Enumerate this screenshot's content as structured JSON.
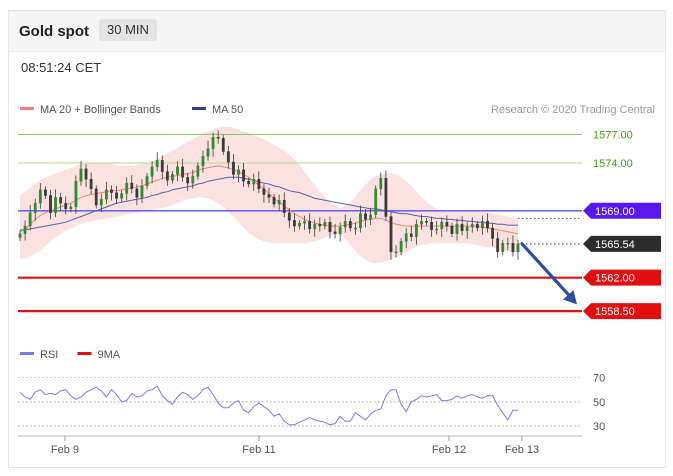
{
  "header": {
    "title": "Gold spot",
    "interval": "30 MIN"
  },
  "timestamp": "08:51:24 CET",
  "legend_price": [
    {
      "label": "MA 20 + Bollinger Bands",
      "color": "#f08080"
    },
    {
      "label": "MA 50",
      "color": "#2e3f8f"
    }
  ],
  "credit": "Research © 2020 Trading Central",
  "legend_rsi": [
    {
      "label": "RSI",
      "color": "#7b7be8"
    },
    {
      "label": "9MA",
      "color": "#e01010"
    }
  ],
  "chart_data": {
    "type": "candlestick",
    "price_ylim": [
      1556,
      1578.5
    ],
    "x_ticks": [
      {
        "label": "Feb 9",
        "index": 8
      },
      {
        "label": "Feb 11",
        "index": 42
      },
      {
        "label": "Feb 12",
        "index": 77
      },
      {
        "label": "Feb 13",
        "index": 89
      }
    ],
    "levels": [
      {
        "label": "1577.00",
        "value": 1577.0,
        "kind": "green",
        "color": "#7ec95a",
        "text_color": "#44a012"
      },
      {
        "label": "1574.00",
        "value": 1574.0,
        "kind": "green",
        "color": "#b6d98a",
        "text_color": "#44a012"
      },
      {
        "label": "1569.00",
        "value": 1569.0,
        "kind": "resistance",
        "color": "#6a6af0",
        "tag_color": "#5a18f0"
      },
      {
        "label": "1565.54",
        "value": 1565.54,
        "kind": "last",
        "color": "#333333",
        "tag_color": "#2c2c2c"
      },
      {
        "label": "1562.00",
        "value": 1562.0,
        "kind": "support",
        "color": "#e01010",
        "tag_color": "#e01010"
      },
      {
        "label": "1558.50",
        "value": 1558.5,
        "kind": "support",
        "color": "#e01010",
        "tag_color": "#e01010"
      }
    ],
    "close": [
      1566.6,
      1567.4,
      1568.8,
      1569.8,
      1571.2,
      1570.6,
      1568.8,
      1570.4,
      1569.8,
      1569.2,
      1569.4,
      1572.1,
      1573.4,
      1572.3,
      1571.3,
      1569.6,
      1570.2,
      1571.2,
      1570.9,
      1570.3,
      1570.8,
      1571.9,
      1571.3,
      1570.4,
      1571.6,
      1572.6,
      1573.6,
      1574.3,
      1573.1,
      1572.2,
      1572.8,
      1573.6,
      1572.5,
      1571.9,
      1572.6,
      1573.7,
      1574.7,
      1575.5,
      1576.7,
      1576.6,
      1575.2,
      1574.1,
      1572.8,
      1573.3,
      1572.1,
      1571.8,
      1572.3,
      1571.3,
      1570.7,
      1570.4,
      1569.7,
      1570.1,
      1568.8,
      1568.0,
      1567.4,
      1567.7,
      1567.9,
      1567.1,
      1567.6,
      1567.4,
      1567.8,
      1566.8,
      1566.6,
      1567.3,
      1567.9,
      1567.2,
      1567.2,
      1568.7,
      1568.1,
      1568.6,
      1571.3,
      1572.4,
      1568.4,
      1564.7,
      1564.7,
      1565.8,
      1566.6,
      1566.3,
      1567.6,
      1567.9,
      1567.8,
      1567.0,
      1567.1,
      1567.8,
      1567.4,
      1566.6,
      1567.6,
      1566.9,
      1567.3,
      1567.6,
      1567.2,
      1567.9,
      1567.2,
      1566.1,
      1564.7,
      1565.6,
      1565.6,
      1564.7,
      1565.5
    ],
    "ma20": [
      1566.8,
      1567.0,
      1567.6,
      1568.1,
      1568.5,
      1568.8,
      1569.0,
      1569.2,
      1569.4,
      1569.6,
      1569.8,
      1570.1,
      1570.4,
      1570.6,
      1570.7,
      1570.8,
      1570.9,
      1571.0,
      1571.1,
      1571.1,
      1571.2,
      1571.3,
      1571.4,
      1571.5,
      1571.6,
      1571.8,
      1572.0,
      1572.2,
      1572.4,
      1572.5,
      1572.6,
      1572.7,
      1572.8,
      1572.9,
      1573.0,
      1573.2,
      1573.4,
      1573.5,
      1573.6,
      1573.7,
      1573.6,
      1573.5,
      1573.3,
      1573.1,
      1572.8,
      1572.5,
      1572.1,
      1571.7,
      1571.3,
      1570.8,
      1570.3,
      1569.9,
      1569.5,
      1569.1,
      1568.7,
      1568.4,
      1568.1,
      1567.9,
      1567.7,
      1567.6,
      1567.5,
      1567.4,
      1567.4,
      1567.4,
      1567.5,
      1567.6,
      1567.7,
      1567.9,
      1568.0,
      1568.1,
      1568.2,
      1568.2,
      1568.0,
      1567.8,
      1567.6,
      1567.5,
      1567.4,
      1567.4,
      1567.4,
      1567.4,
      1567.4,
      1567.4,
      1567.4,
      1567.4,
      1567.4,
      1567.4,
      1567.4,
      1567.4,
      1567.4,
      1567.4,
      1567.4,
      1567.3,
      1567.2,
      1567.1,
      1567.0,
      1566.9,
      1566.8,
      1566.7,
      1566.6
    ],
    "bb_upper": [
      1570.6,
      1571.0,
      1571.4,
      1571.8,
      1572.2,
      1572.5,
      1572.7,
      1572.9,
      1573.1,
      1573.3,
      1573.5,
      1573.7,
      1573.9,
      1574.0,
      1574.0,
      1574.0,
      1574.0,
      1574.0,
      1573.9,
      1573.8,
      1573.7,
      1573.7,
      1573.7,
      1573.8,
      1573.9,
      1574.0,
      1574.2,
      1574.4,
      1574.7,
      1575.0,
      1575.3,
      1575.6,
      1575.9,
      1576.2,
      1576.5,
      1576.8,
      1577.1,
      1577.3,
      1577.5,
      1577.7,
      1577.8,
      1577.8,
      1577.7,
      1577.5,
      1577.3,
      1577.1,
      1576.9,
      1576.7,
      1576.5,
      1576.2,
      1575.9,
      1575.6,
      1575.3,
      1574.9,
      1574.4,
      1573.8,
      1573.1,
      1572.4,
      1571.7,
      1571.0,
      1570.4,
      1569.9,
      1569.5,
      1569.3,
      1569.5,
      1569.9,
      1570.5,
      1571.2,
      1571.8,
      1572.3,
      1572.6,
      1572.8,
      1572.9,
      1572.9,
      1572.8,
      1572.5,
      1572.1,
      1571.6,
      1571.0,
      1570.4,
      1569.9,
      1569.5,
      1569.2,
      1569.0,
      1568.9,
      1568.9,
      1568.9,
      1568.9,
      1568.9,
      1568.9,
      1568.9,
      1568.9,
      1568.8,
      1568.7,
      1568.6,
      1568.5,
      1568.4,
      1568.3,
      1568.2
    ],
    "bb_lower": [
      1564.0,
      1564.0,
      1564.2,
      1564.5,
      1564.9,
      1565.3,
      1565.8,
      1566.2,
      1566.6,
      1566.9,
      1567.2,
      1567.4,
      1567.6,
      1567.8,
      1567.9,
      1568.0,
      1568.1,
      1568.2,
      1568.3,
      1568.4,
      1568.5,
      1568.6,
      1568.7,
      1568.8,
      1568.9,
      1569.0,
      1569.1,
      1569.2,
      1569.3,
      1569.4,
      1569.6,
      1569.8,
      1570.0,
      1570.2,
      1570.3,
      1570.4,
      1570.4,
      1570.3,
      1570.1,
      1569.8,
      1569.4,
      1568.9,
      1568.4,
      1567.8,
      1567.2,
      1566.7,
      1566.3,
      1566.0,
      1565.8,
      1565.7,
      1565.6,
      1565.6,
      1565.6,
      1565.6,
      1565.6,
      1565.6,
      1565.6,
      1565.7,
      1565.8,
      1566.0,
      1566.2,
      1566.4,
      1566.6,
      1566.4,
      1566.0,
      1565.4,
      1564.8,
      1564.3,
      1563.9,
      1563.6,
      1563.5,
      1563.6,
      1563.7,
      1563.9,
      1564.1,
      1564.4,
      1564.7,
      1565.0,
      1565.2,
      1565.4,
      1565.5,
      1565.6,
      1565.6,
      1565.6,
      1565.6,
      1565.6,
      1565.6,
      1565.6,
      1565.6,
      1565.5,
      1565.4,
      1565.3,
      1565.2,
      1565.1,
      1565.0,
      1564.9,
      1564.8,
      1564.7,
      1564.6
    ],
    "ma50": [
      1567.0,
      1567.0,
      1567.1,
      1567.2,
      1567.3,
      1567.4,
      1567.5,
      1567.6,
      1567.7,
      1567.8,
      1568.0,
      1568.2,
      1568.4,
      1568.6,
      1568.8,
      1569.0,
      1569.2,
      1569.4,
      1569.6,
      1569.8,
      1569.9,
      1570.0,
      1570.1,
      1570.2,
      1570.3,
      1570.4,
      1570.6,
      1570.7,
      1570.9,
      1571.0,
      1571.2,
      1571.3,
      1571.4,
      1571.5,
      1571.6,
      1571.8,
      1571.9,
      1572.1,
      1572.2,
      1572.3,
      1572.4,
      1572.5,
      1572.5,
      1572.5,
      1572.4,
      1572.3,
      1572.2,
      1572.0,
      1571.9,
      1571.8,
      1571.6,
      1571.5,
      1571.3,
      1571.1,
      1571.0,
      1570.9,
      1570.7,
      1570.5,
      1570.3,
      1570.2,
      1570.1,
      1570.0,
      1569.9,
      1569.8,
      1569.7,
      1569.6,
      1569.5,
      1569.4,
      1569.3,
      1569.2,
      1569.2,
      1569.1,
      1569.0,
      1568.9,
      1568.8,
      1568.7,
      1568.7,
      1568.6,
      1568.5,
      1568.4,
      1568.4,
      1568.3,
      1568.2,
      1568.2,
      1568.1,
      1568.1,
      1568.0,
      1568.0,
      1567.9,
      1567.9,
      1567.8,
      1567.8,
      1567.7,
      1567.7,
      1567.6,
      1567.6,
      1567.5,
      1567.5,
      1567.5
    ],
    "forecast_arrow": [
      1565.54,
      1559.2
    ],
    "rsi_ylim": [
      25,
      78
    ],
    "rsi_ticks": [
      70,
      50,
      30
    ],
    "rsi_levels_dotted": [
      70,
      50,
      30
    ],
    "rsi": [
      58,
      54,
      52,
      58,
      60,
      56,
      57,
      56,
      59,
      60,
      55,
      52,
      54,
      58,
      60,
      62,
      59,
      54,
      60,
      56,
      50,
      51,
      57,
      54,
      55,
      59,
      60,
      63,
      55,
      51,
      48,
      54,
      58,
      56,
      52,
      55,
      60,
      62,
      56,
      49,
      45,
      45,
      49,
      51,
      43,
      41,
      46,
      49,
      46,
      43,
      38,
      40,
      34,
      31,
      31,
      33,
      35,
      37,
      35,
      34,
      33,
      31,
      32,
      38,
      34,
      34,
      41,
      38,
      35,
      40,
      43,
      44,
      55,
      60,
      60,
      48,
      42,
      50,
      52,
      55,
      54,
      55,
      56,
      51,
      51,
      52,
      55,
      53,
      55,
      56,
      54,
      53,
      55,
      55,
      47,
      41,
      35,
      43,
      43
    ],
    "rsi_ma9": [
      56,
      56,
      56,
      56,
      57,
      57,
      57,
      57,
      57,
      57,
      57,
      56,
      56,
      56,
      57,
      57,
      57,
      57,
      57,
      57,
      56,
      56,
      56,
      56,
      55,
      55,
      56,
      57,
      57,
      56,
      55,
      55,
      55,
      55,
      55,
      55,
      56,
      56,
      56,
      55,
      54,
      53,
      52,
      51,
      49,
      48,
      47,
      47,
      46,
      45,
      44,
      43,
      41,
      39,
      38,
      37,
      36,
      36,
      35,
      35,
      35,
      34,
      34,
      34,
      34,
      34,
      35,
      35,
      36,
      37,
      38,
      40,
      43,
      46,
      48,
      49,
      50,
      51,
      52,
      53,
      53,
      53,
      53,
      53,
      53,
      53,
      53,
      53,
      54,
      54,
      54,
      54,
      54,
      54,
      53,
      51,
      49,
      48,
      47
    ]
  }
}
